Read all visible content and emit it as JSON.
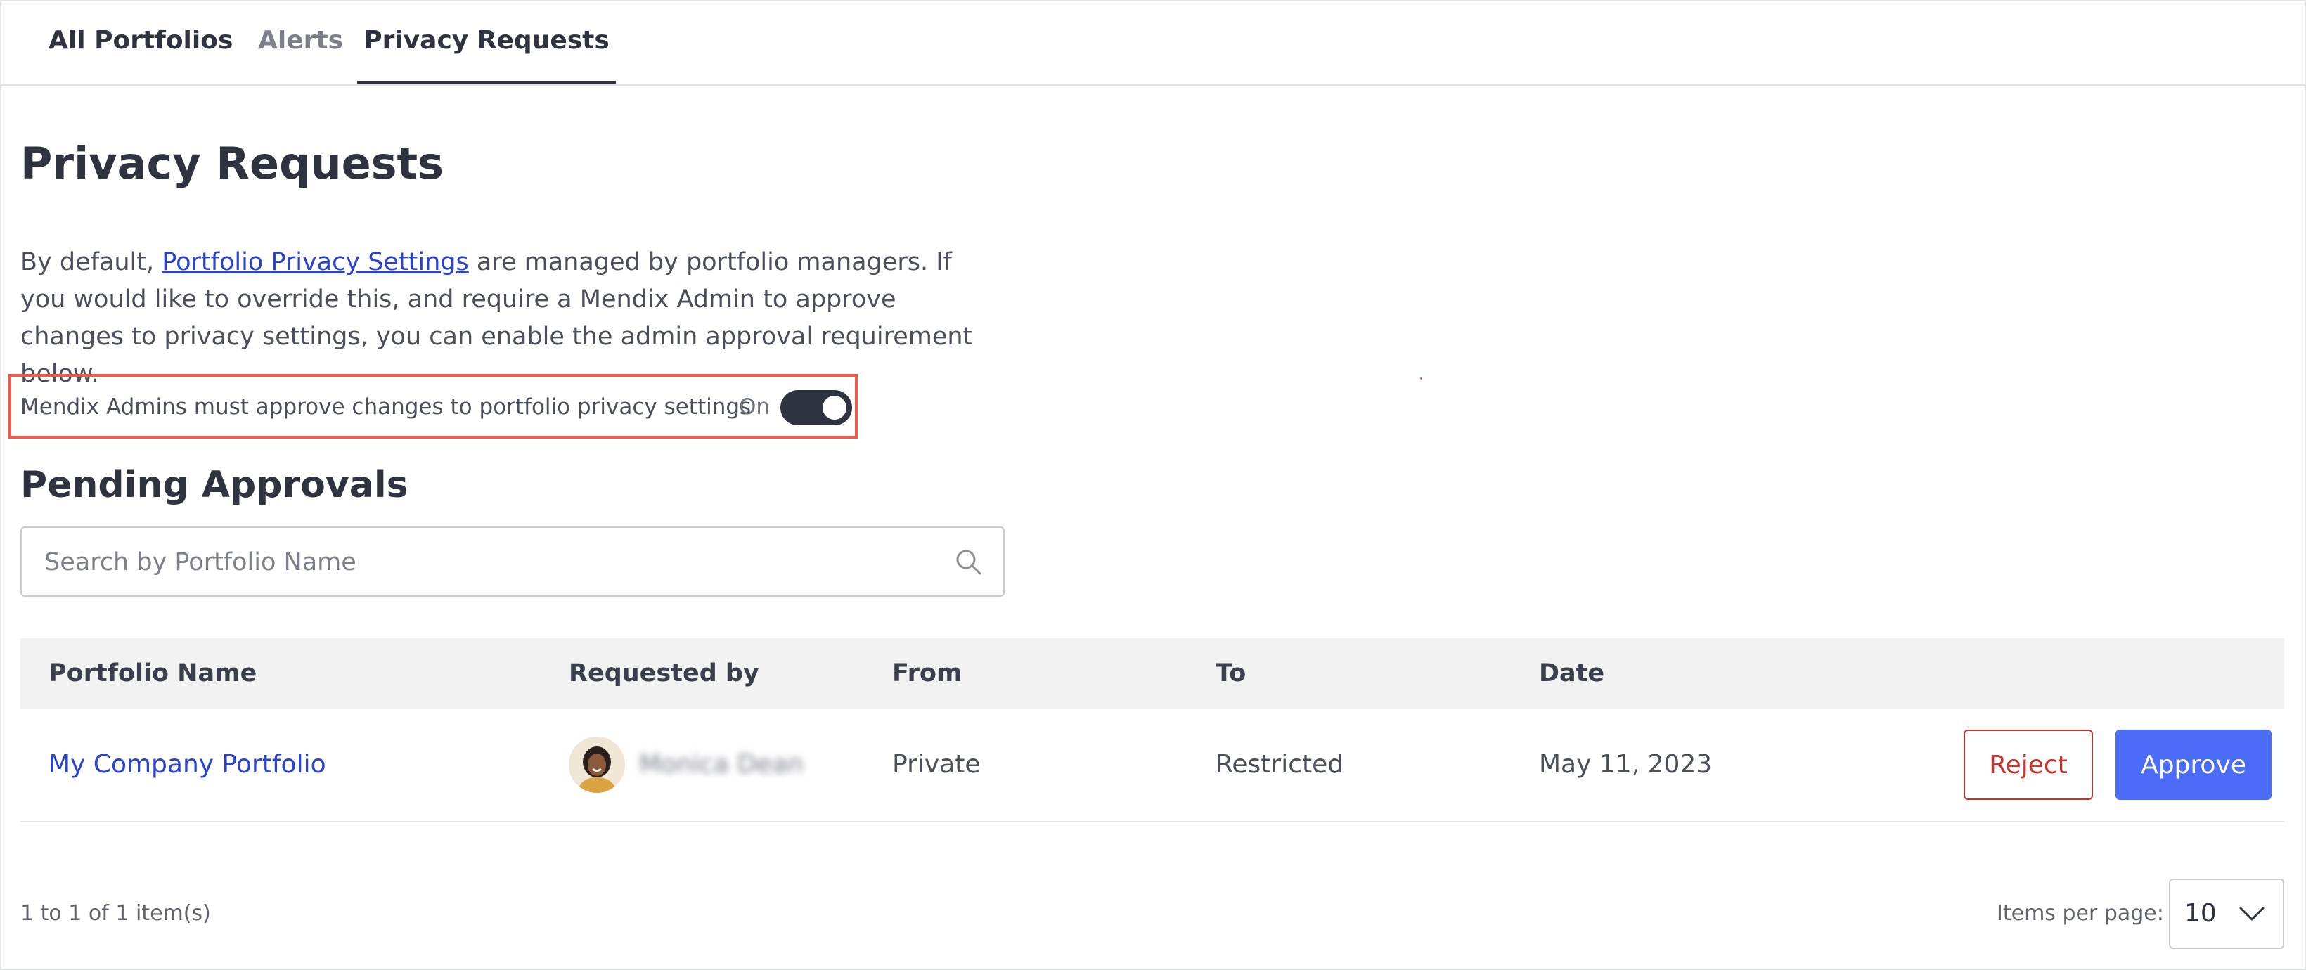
{
  "tabs": {
    "all_portfolios": "All Portfolios",
    "alerts": "Alerts",
    "privacy_requests": "Privacy Requests"
  },
  "page": {
    "title": "Privacy Requests",
    "desc_before": "By default, ",
    "desc_link": "Portfolio Privacy Settings",
    "desc_after": " are managed by portfolio managers. If you would like to override this, and require a Mendix Admin to approve changes to privacy settings, you can enable the admin approval requirement below."
  },
  "setting": {
    "label": "Mendix Admins must approve changes to portfolio privacy settings",
    "state": "On",
    "enabled": true
  },
  "pending": {
    "title": "Pending Approvals",
    "search_placeholder": "Search by Portfolio Name",
    "search_icon": "search-icon"
  },
  "table": {
    "columns": {
      "portfolio_name": "Portfolio Name",
      "requested_by": "Requested by",
      "from": "From",
      "to": "To",
      "date": "Date"
    },
    "rows": [
      {
        "portfolio_name": "My Company Portfolio",
        "requested_by": "Monica Dean",
        "from": "Private",
        "to": "Restricted",
        "date": "May 11, 2023",
        "reject_label": "Reject",
        "approve_label": "Approve"
      }
    ]
  },
  "pagination": {
    "count": "1 to 1 of 1 item(s)",
    "items_per_page_label": "Items per page:",
    "items_per_page": "10"
  },
  "colors": {
    "accent": "#4a6cf7",
    "link": "#2742d4",
    "reject": "#c6342b",
    "highlight": "#ef5b49",
    "toggle_on": "#2f3340"
  }
}
